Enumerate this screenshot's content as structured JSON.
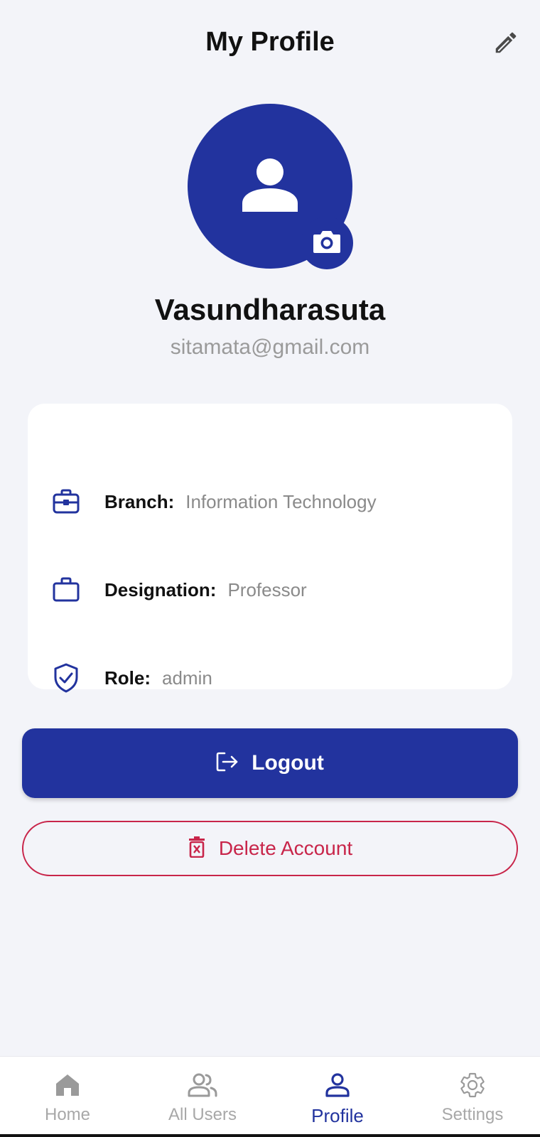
{
  "header": {
    "title": "My Profile",
    "edit_icon": "pencil-icon"
  },
  "profile": {
    "avatar_icon": "person-icon",
    "camera_icon": "camera-icon",
    "name": "Vasundharasuta",
    "email": "sitamata@gmail.com"
  },
  "info": {
    "items": [
      {
        "icon": "briefcase-icon",
        "label": "Branch:",
        "value": "Information Technology"
      },
      {
        "icon": "suitcase-icon",
        "label": "Designation:",
        "value": "Professor"
      },
      {
        "icon": "shield-check-icon",
        "label": "Role:",
        "value": "admin"
      }
    ]
  },
  "actions": {
    "logout_label": "Logout",
    "logout_icon": "logout-icon",
    "delete_label": "Delete Account",
    "delete_icon": "trash-icon"
  },
  "nav": {
    "items": [
      {
        "label": "Home",
        "icon": "home-icon",
        "active": false
      },
      {
        "label": "All Users",
        "icon": "users-icon",
        "active": false
      },
      {
        "label": "Profile",
        "icon": "profile-icon",
        "active": true
      },
      {
        "label": "Settings",
        "icon": "gear-icon",
        "active": false
      }
    ]
  },
  "colors": {
    "primary": "#22339e",
    "danger": "#c8254a",
    "background": "#f3f4f9",
    "muted_text": "#9a9a9a"
  }
}
